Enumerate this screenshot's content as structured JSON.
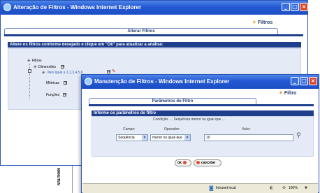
{
  "back_window": {
    "title": "Alteração de Filtros - Windows Internet Explorer",
    "header_label": "Filtros",
    "tab": "Alterar Filtros",
    "instruction": "Altere os filtros conforme desejado e clique em \"Ok\" para atualizar a análise:",
    "tree": {
      "root": "Filtros",
      "dimensoes": "Dimensões",
      "filter_item": "Mes igual a 1,2,3,4,5,6",
      "metricas": "Métricas",
      "funcoes": "Funções"
    },
    "side_text": "MANUTEN"
  },
  "front_window": {
    "title": "Manutenção de Filtros - Windows Internet Explorer",
    "header_label": "Filtro",
    "tab": "Parâmetros do Filtro",
    "section_title": "Informe os parâmetros do filtro",
    "condition": "Condição: ... Sequência menor ou igual que ...",
    "fields": {
      "campo_label": "Campo:",
      "campo_value": "Sequência",
      "operador_label": "Operador:",
      "operador_value": "menor ou igual que",
      "valor_label": "Valor:",
      "valor_value": "10"
    },
    "ok_label": "ok",
    "cancel_label": "cancelar",
    "status": {
      "zone": "Intranet local",
      "zoom": "100%"
    }
  }
}
